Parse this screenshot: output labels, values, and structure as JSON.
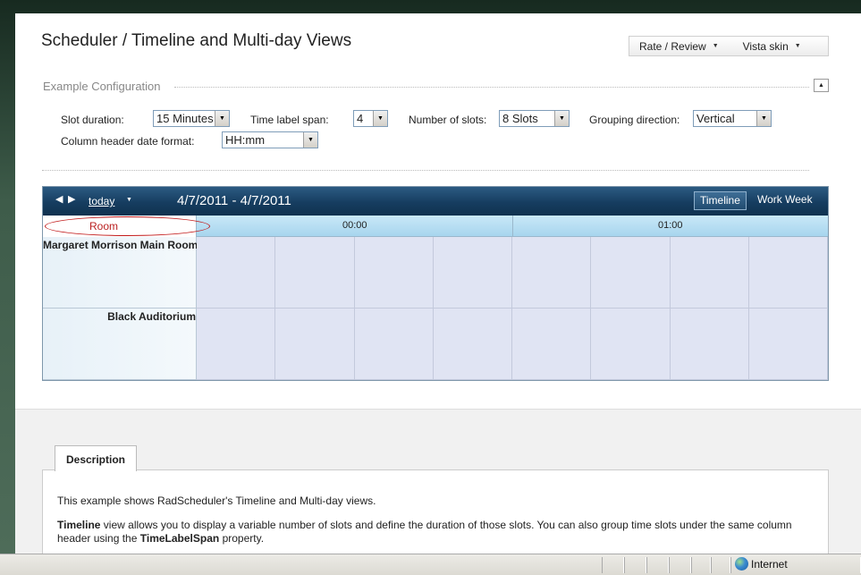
{
  "page": {
    "title": "Scheduler / Timeline and Multi-day Views",
    "rate_review": "Rate / Review",
    "skin": "Vista skin"
  },
  "config": {
    "heading": "Example Configuration",
    "slot_duration": {
      "label": "Slot duration:",
      "value": "15 Minutes"
    },
    "time_label_span": {
      "label": "Time label span:",
      "value": "4"
    },
    "number_of_slots": {
      "label": "Number of slots:",
      "value": "8 Slots"
    },
    "grouping_direction": {
      "label": "Grouping direction:",
      "value": "Vertical"
    },
    "column_header_date_format": {
      "label": "Column header date format:",
      "value": "HH:mm"
    }
  },
  "scheduler": {
    "today": "today",
    "date_range": "4/7/2011 - 4/7/2011",
    "views": [
      "Timeline",
      "Work Week"
    ],
    "active_view": "Timeline",
    "group_header": "Room",
    "time_labels": [
      "00:00",
      "01:00"
    ],
    "resources": [
      "Margaret Morrison Main Room",
      "Black Auditorium"
    ],
    "slots_per_row": 8
  },
  "description": {
    "tab": "Description",
    "line1": "This example shows RadScheduler's Timeline and Multi-day views.",
    "line2_bold": "Timeline",
    "line2_rest": " view allows you to display a variable number of slots and define the duration of those slots. You can also group time slots under the same column",
    "line3_pre": "header using the ",
    "line3_bold": "TimeLabelSpan",
    "line3_post": " property."
  },
  "statusbar": {
    "zone": "Internet"
  },
  "colors": {
    "header_dark": "#163d60",
    "time_header": "#b5dcf1",
    "slot_cell": "#e0e4f3",
    "annotation_red": "#c21a1a"
  }
}
